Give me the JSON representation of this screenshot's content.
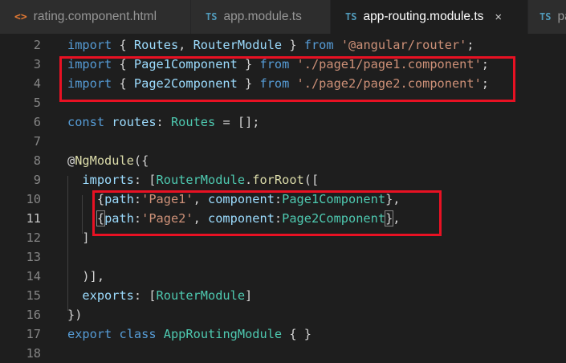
{
  "tabs": [
    {
      "label": "rating.component.html",
      "icon": "<>",
      "icon_kind": "html",
      "active": false
    },
    {
      "label": "app.module.ts",
      "icon": "TS",
      "icon_kind": "ts",
      "active": false
    },
    {
      "label": "app-routing.module.ts",
      "icon": "TS",
      "icon_kind": "ts",
      "active": true,
      "close": "×"
    },
    {
      "label": "pa",
      "icon": "TS",
      "icon_kind": "ts",
      "active": false
    }
  ],
  "editor": {
    "current_line": 11,
    "lines": [
      {
        "num": "2",
        "tokens": [
          [
            "kw",
            "import"
          ],
          [
            "p",
            " { "
          ],
          [
            "var",
            "Routes"
          ],
          [
            "p",
            ", "
          ],
          [
            "var",
            "RouterModule"
          ],
          [
            "p",
            " } "
          ],
          [
            "kw",
            "from"
          ],
          [
            "p",
            " "
          ],
          [
            "str",
            "'@angular/router'"
          ],
          [
            "p",
            ";"
          ]
        ]
      },
      {
        "num": "3",
        "tokens": [
          [
            "kw",
            "import"
          ],
          [
            "p",
            " { "
          ],
          [
            "var",
            "Page1Component"
          ],
          [
            "p",
            " } "
          ],
          [
            "kw",
            "from"
          ],
          [
            "p",
            " "
          ],
          [
            "str",
            "'./page1/page1.component'"
          ],
          [
            "p",
            ";"
          ]
        ]
      },
      {
        "num": "4",
        "tokens": [
          [
            "kw",
            "import"
          ],
          [
            "p",
            " { "
          ],
          [
            "var",
            "Page2Component"
          ],
          [
            "p",
            " } "
          ],
          [
            "kw",
            "from"
          ],
          [
            "p",
            " "
          ],
          [
            "str",
            "'./page2/page2.component'"
          ],
          [
            "p",
            ";"
          ]
        ]
      },
      {
        "num": "5",
        "tokens": []
      },
      {
        "num": "6",
        "tokens": [
          [
            "kw",
            "const"
          ],
          [
            "p",
            " "
          ],
          [
            "var",
            "routes"
          ],
          [
            "p",
            ": "
          ],
          [
            "cls",
            "Routes"
          ],
          [
            "p",
            " = [];"
          ]
        ]
      },
      {
        "num": "7",
        "tokens": []
      },
      {
        "num": "8",
        "tokens": [
          [
            "p",
            "@"
          ],
          [
            "fn",
            "NgModule"
          ],
          [
            "p",
            "({"
          ]
        ]
      },
      {
        "num": "9",
        "tokens": [
          [
            "p",
            "  "
          ],
          [
            "var",
            "imports"
          ],
          [
            "p",
            ": ["
          ],
          [
            "cls",
            "RouterModule"
          ],
          [
            "p",
            "."
          ],
          [
            "fn",
            "forRoot"
          ],
          [
            "p",
            "(["
          ]
        ]
      },
      {
        "num": "10",
        "tokens": [
          [
            "p",
            "    {"
          ],
          [
            "var",
            "path"
          ],
          [
            "p",
            ":"
          ],
          [
            "str",
            "'Page1'"
          ],
          [
            "p",
            ", "
          ],
          [
            "var",
            "component"
          ],
          [
            "p",
            ":"
          ],
          [
            "cls",
            "Page1Component"
          ],
          [
            "p",
            "},"
          ]
        ]
      },
      {
        "num": "11",
        "tokens": [
          [
            "p",
            "    "
          ],
          [
            "pb",
            "{"
          ],
          [
            "var",
            "path"
          ],
          [
            "p",
            ":"
          ],
          [
            "str",
            "'Page2'"
          ],
          [
            "p",
            ", "
          ],
          [
            "var",
            "component"
          ],
          [
            "p",
            ":"
          ],
          [
            "cls",
            "Page2Component"
          ],
          [
            "pb",
            "}"
          ],
          [
            "p",
            ","
          ]
        ]
      },
      {
        "num": "12",
        "tokens": [
          [
            "p",
            "  ]"
          ]
        ]
      },
      {
        "num": "13",
        "tokens": []
      },
      {
        "num": "14",
        "tokens": [
          [
            "p",
            "  )],"
          ]
        ]
      },
      {
        "num": "15",
        "tokens": [
          [
            "p",
            "  "
          ],
          [
            "var",
            "exports"
          ],
          [
            "p",
            ": ["
          ],
          [
            "cls",
            "RouterModule"
          ],
          [
            "p",
            "]"
          ]
        ]
      },
      {
        "num": "16",
        "tokens": [
          [
            "p",
            "})"
          ]
        ]
      },
      {
        "num": "17",
        "tokens": [
          [
            "kw",
            "export"
          ],
          [
            "p",
            " "
          ],
          [
            "kw",
            "class"
          ],
          [
            "p",
            " "
          ],
          [
            "cls",
            "AppRoutingModule"
          ],
          [
            "p",
            " { }"
          ]
        ]
      },
      {
        "num": "18",
        "tokens": []
      }
    ]
  },
  "colors": {
    "background": "#1e1e1e",
    "keyword": "#569cd6",
    "type": "#4ec9b0",
    "string": "#ce9178",
    "variable": "#9cdcfe",
    "function": "#dcdcaa",
    "punctuation": "#d4d4d4",
    "highlight_box": "#e81123"
  }
}
